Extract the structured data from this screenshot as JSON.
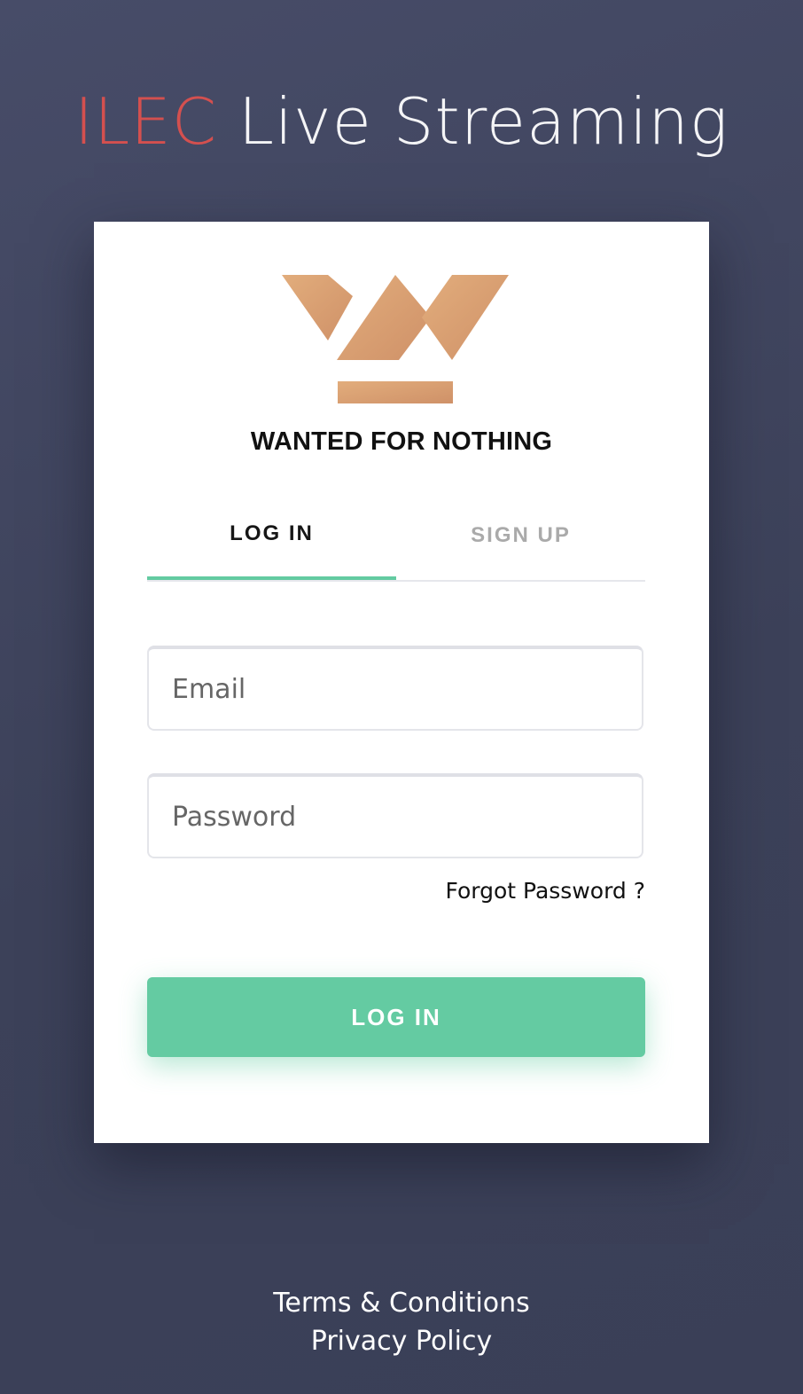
{
  "header": {
    "brand": "ILEC",
    "title_rest": "Live Streaming"
  },
  "card": {
    "logo": "wanted-for-nothing-logo",
    "org_name": "WANTED FOR NOTHING",
    "tabs": [
      {
        "label": "LOG IN",
        "active": true
      },
      {
        "label": "SIGN UP",
        "active": false
      }
    ],
    "email": {
      "value": "",
      "placeholder": "Email"
    },
    "password": {
      "value": "",
      "placeholder": "Password"
    },
    "forgot_label": "Forgot Password ?",
    "login_button": "LOG IN"
  },
  "footer": {
    "terms": "Terms & Conditions",
    "privacy": "Privacy Policy"
  },
  "colors": {
    "background": "#43475f",
    "brand_red": "#d4504f",
    "accent_green": "#64cba2",
    "logo_gold": "#d9a274"
  }
}
